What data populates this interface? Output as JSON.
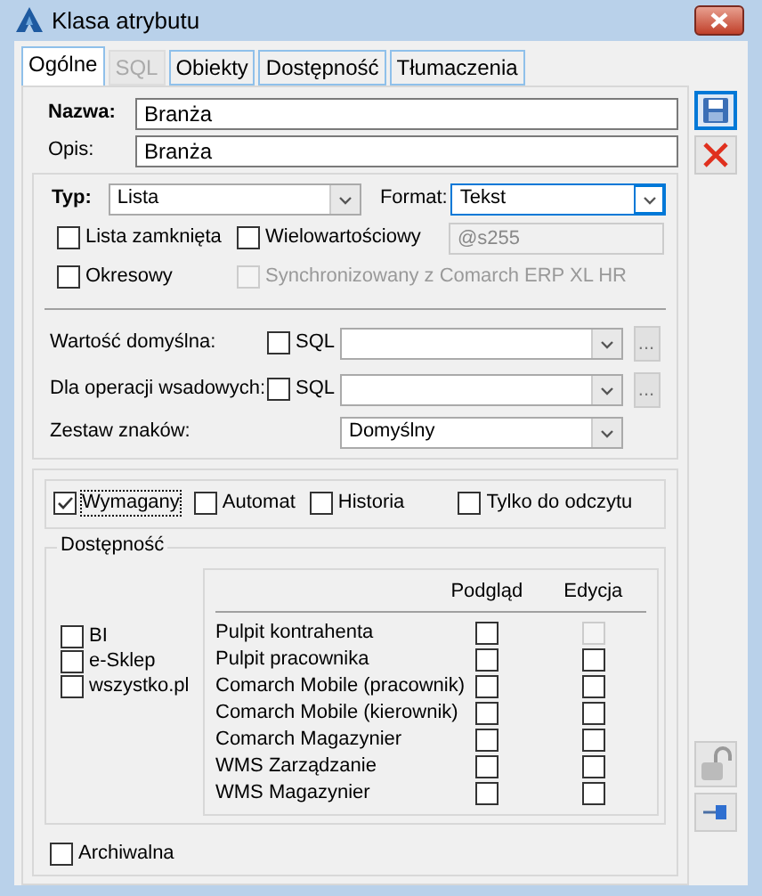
{
  "window": {
    "title": "Klasa atrybutu"
  },
  "tabs": [
    {
      "label": "Ogólne",
      "selected": true,
      "disabled": false
    },
    {
      "label": "SQL",
      "selected": false,
      "disabled": true
    },
    {
      "label": "Obiekty",
      "selected": false,
      "disabled": false
    },
    {
      "label": "Dostępność",
      "selected": false,
      "disabled": false
    },
    {
      "label": "Tłumaczenia",
      "selected": false,
      "disabled": false
    }
  ],
  "fields": [
    {
      "label": "Nazwa:",
      "value": "Branża"
    },
    {
      "label": "Opis:",
      "value": "Branża"
    }
  ],
  "type": {
    "label": "Typ:",
    "value": "Lista",
    "focused": false
  },
  "format": {
    "label": "Format:",
    "value": "Tekst",
    "focused": true
  },
  "options": [
    {
      "label": "Lista zamknięta",
      "checked": false,
      "disabled": false
    },
    {
      "label": "Wielowartościowy",
      "checked": false,
      "disabled": false
    },
    {
      "label": "Okresowy",
      "checked": false,
      "disabled": false
    },
    {
      "label": "Synchronizowany z Comarch ERP XL HR",
      "checked": false,
      "disabled": true
    }
  ],
  "format_code": {
    "value": "@s255"
  },
  "defaults": [
    {
      "label": "Wartość domyślna:",
      "sql_label": "SQL",
      "sql_checked": false,
      "button": "..."
    },
    {
      "label": "Dla operacji wsadowych:",
      "sql_label": "SQL",
      "sql_checked": false,
      "button": "..."
    }
  ],
  "charset": {
    "label": "Zestaw znaków:",
    "value": "Domyślny"
  },
  "flags": [
    {
      "label": "Wymagany",
      "checked": true,
      "focused": true
    },
    {
      "label": "Automat",
      "checked": false,
      "focused": false
    },
    {
      "label": "Historia",
      "checked": false,
      "focused": false
    },
    {
      "label": "Tylko do odczytu",
      "checked": false,
      "focused": false
    }
  ],
  "availability": {
    "title": "Dostępność",
    "channels": [
      {
        "label": "BI",
        "checked": false
      },
      {
        "label": "e-Sklep",
        "checked": false
      },
      {
        "label": "wszystko.pl",
        "checked": false
      }
    ],
    "columns": [
      "Podgląd",
      "Edycja"
    ],
    "rows": [
      {
        "label": "Pulpit kontrahenta",
        "preview": false,
        "edit": false,
        "edit_disabled": true
      },
      {
        "label": "Pulpit pracownika",
        "preview": false,
        "edit": false,
        "edit_disabled": false
      },
      {
        "label": "Comarch Mobile (pracownik)",
        "preview": false,
        "edit": false,
        "edit_disabled": false
      },
      {
        "label": "Comarch Mobile (kierownik)",
        "preview": false,
        "edit": false,
        "edit_disabled": false
      },
      {
        "label": "Comarch Magazynier",
        "preview": false,
        "edit": false,
        "edit_disabled": false
      },
      {
        "label": "WMS Zarządzanie",
        "preview": false,
        "edit": false,
        "edit_disabled": false
      },
      {
        "label": "WMS Magazynier",
        "preview": false,
        "edit": false,
        "edit_disabled": false
      }
    ]
  },
  "archived": {
    "label": "Archiwalna",
    "checked": false
  }
}
